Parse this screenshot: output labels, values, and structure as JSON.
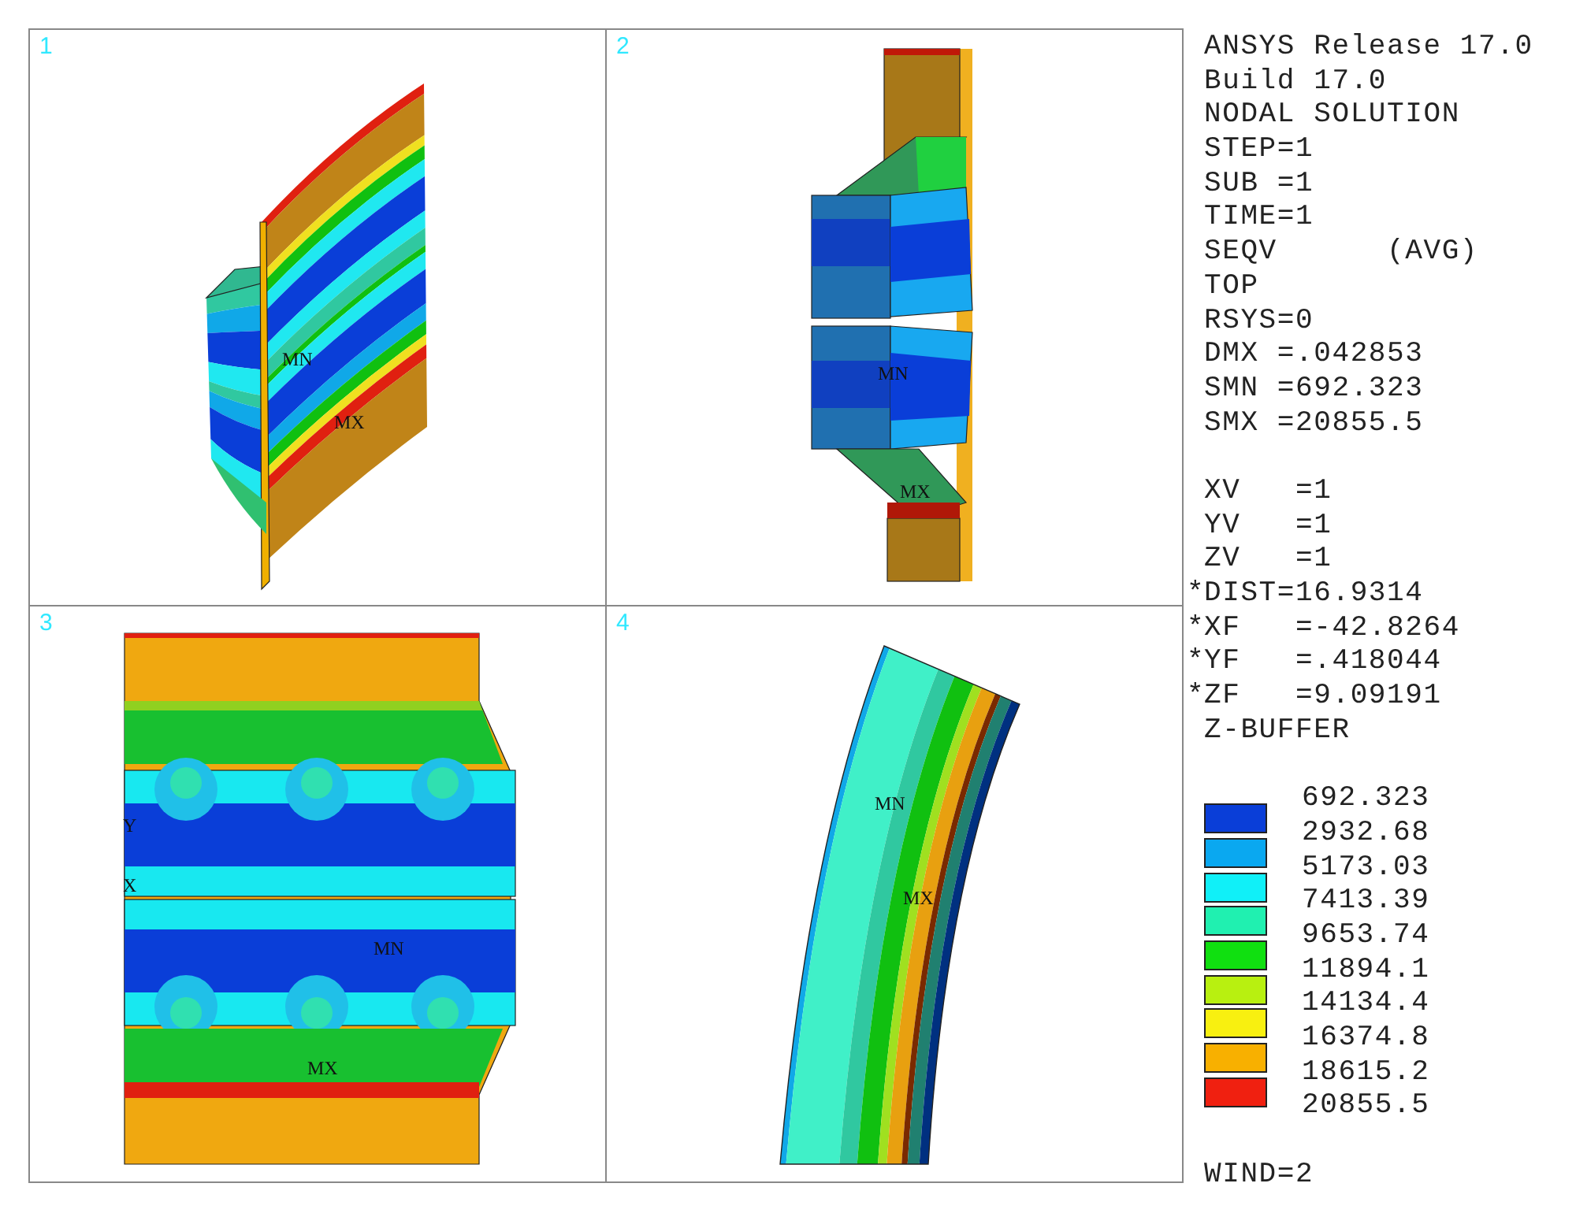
{
  "viewports": [
    {
      "number": "1",
      "kind": "iso",
      "labels": [
        {
          "text": "MN"
        },
        {
          "text": "MX"
        }
      ]
    },
    {
      "number": "2",
      "kind": "front",
      "labels": [
        {
          "text": "MN"
        },
        {
          "text": "MX"
        }
      ]
    },
    {
      "number": "3",
      "kind": "plan",
      "labels": [
        {
          "text": "Y"
        },
        {
          "text": "X"
        },
        {
          "text": "MN"
        },
        {
          "text": "MX"
        }
      ]
    },
    {
      "number": "4",
      "kind": "side",
      "labels": [
        {
          "text": "MN"
        },
        {
          "text": "MX"
        }
      ]
    }
  ],
  "info_groups": [
    [
      {
        "text": "ANSYS Release 17.0"
      },
      {
        "text": "Build 17.0"
      },
      {
        "text": "NODAL SOLUTION"
      },
      {
        "text": "STEP=1"
      },
      {
        "text": "SUB =1"
      },
      {
        "text": "TIME=1"
      },
      {
        "text": "SEQV      (AVG)"
      },
      {
        "text": "TOP"
      },
      {
        "text": "RSYS=0"
      },
      {
        "text": "DMX =.042853"
      },
      {
        "text": "SMN =692.323"
      },
      {
        "text": "SMX =20855.5"
      }
    ],
    [
      {
        "text": "XV   =1"
      },
      {
        "text": "YV   =1"
      },
      {
        "text": "ZV   =1"
      },
      {
        "marker": "*",
        "text": "DIST=16.9314"
      },
      {
        "marker": "*",
        "text": "XF   =-42.8264"
      },
      {
        "marker": "*",
        "text": "YF   =.418044"
      },
      {
        "marker": "*",
        "text": "ZF   =9.09191"
      },
      {
        "text": "Z-BUFFER"
      }
    ]
  ],
  "legend": {
    "values": [
      "692.323",
      "2932.68",
      "5173.03",
      "7413.39",
      "9653.74",
      "11894.1",
      "14134.4",
      "16374.8",
      "18615.2",
      "20855.5"
    ],
    "bands": [
      {
        "color": "#0a3ed8"
      },
      {
        "color": "#0aa8f0"
      },
      {
        "color": "#10f0f8"
      },
      {
        "color": "#20f0b0"
      },
      {
        "color": "#10e010"
      },
      {
        "color": "#b8f010"
      },
      {
        "color": "#f8f010"
      },
      {
        "color": "#f8b000"
      },
      {
        "color": "#f02010"
      }
    ]
  },
  "window_number": "WIND=2"
}
